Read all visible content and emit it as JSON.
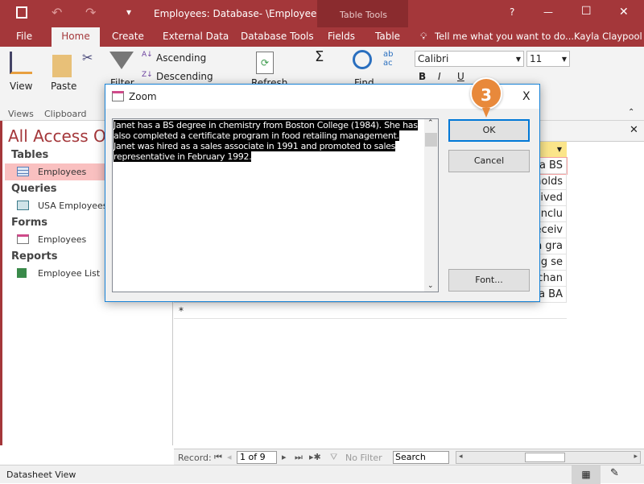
{
  "titlebar": {
    "title": "Employees: Database- \\Employees...",
    "context_tab": "Table Tools",
    "help": "?",
    "minimize": "—",
    "maximize": "☐",
    "close": "✕"
  },
  "tabs": [
    "File",
    "Home",
    "Create",
    "External Data",
    "Database Tools",
    "Fields",
    "Table"
  ],
  "tell_me": "Tell me what you want to do...",
  "user": "Kayla Claypool",
  "ribbon": {
    "view": "View",
    "paste": "Paste",
    "filter": "Filter",
    "ascending": "Ascending",
    "descending": "Descending",
    "refresh": "Refresh",
    "find": "Find",
    "font_name": "Calibri",
    "font_size": "11",
    "groups": {
      "views": "Views",
      "clipboard": "Clipboard"
    }
  },
  "nav": {
    "title": "All Access Ob",
    "sections": [
      {
        "header": "Tables",
        "items": [
          "Employees"
        ]
      },
      {
        "header": "Queries",
        "items": [
          "USA Employees"
        ]
      },
      {
        "header": "Forms",
        "items": [
          "Employees"
        ]
      },
      {
        "header": "Reports",
        "items": [
          "Employee List"
        ]
      }
    ]
  },
  "sheet": {
    "cells": [
      "a BS",
      "holds",
      "eived",
      "n inclu",
      "eceiv",
      "s a gra",
      "ng se",
      "uchan",
      "a BA"
    ],
    "new_row": "*"
  },
  "record_nav": {
    "label": "Record:",
    "position": "1 of 9",
    "no_filter": "No Filter",
    "search": "Search"
  },
  "status": {
    "text": "Datasheet View"
  },
  "dialog": {
    "title": "Zoom",
    "text": "Janet has a BS degree in chemistry from Boston College (1984).  She has also completed a certificate program in food retailing management.  Janet was hired as a sales associate in 1991 and promoted to sales representative in February 1992.",
    "ok": "OK",
    "cancel": "Cancel",
    "font": "Font...",
    "close": "X"
  },
  "callout": {
    "step": "3",
    "color": "#e8893b"
  },
  "colors": {
    "accent": "#a4373a",
    "selected_nav": "#f9c0c0",
    "header_highlight": "#fbe58a"
  }
}
